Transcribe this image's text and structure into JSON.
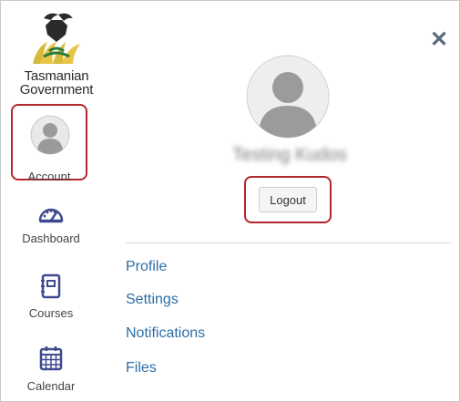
{
  "logo": {
    "line1": "Tasmanian",
    "line2": "Government"
  },
  "sidebar": {
    "items": [
      {
        "label": "Account",
        "icon": "account-avatar-icon"
      },
      {
        "label": "Dashboard",
        "icon": "dashboard-gauge-icon"
      },
      {
        "label": "Courses",
        "icon": "courses-book-icon"
      },
      {
        "label": "Calendar",
        "icon": "calendar-icon"
      }
    ]
  },
  "panel": {
    "close_label": "✕",
    "user_name": "Testing Kudos",
    "logout_label": "Logout",
    "links": [
      "Profile",
      "Settings",
      "Notifications",
      "Files"
    ]
  },
  "colors": {
    "highlight_border": "#b3262b",
    "link": "#2b6ea8",
    "nav_icon": "#3f4a8f"
  }
}
